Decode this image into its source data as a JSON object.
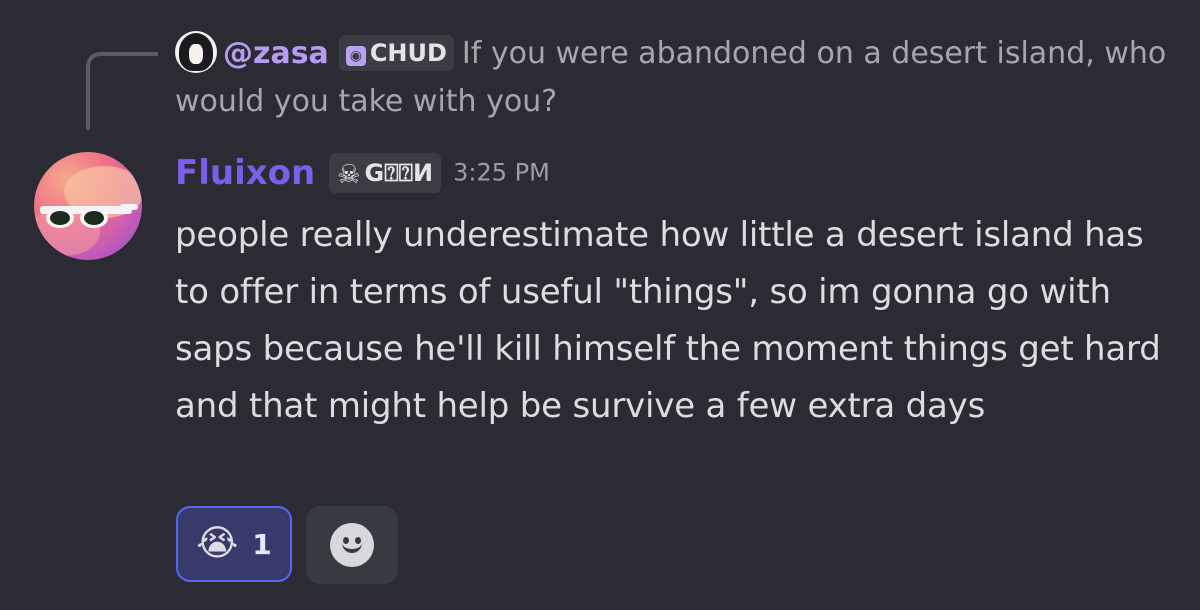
{
  "reply": {
    "username": "@zasa",
    "tag": "CHUD",
    "tag_icon": "shield-emblem-icon",
    "text": "If you were abandoned on a desert island, who would you take with you?"
  },
  "message": {
    "author": "Fluixon",
    "author_color": "#7c5ee8",
    "tag": "G⍰⍰И",
    "tag_icon": "skull-icon",
    "timestamp": "3:25 PM",
    "body": "people really underestimate how little a desert island has to offer in terms of useful \"things\", so im gonna go with saps because he'll kill himself the moment things get hard and that might help be survive a few extra days"
  },
  "reactions": [
    {
      "emoji": "😭",
      "emoji_name": "loudly-crying-face",
      "count": "1",
      "active": true
    }
  ],
  "add_reaction_icon": "smiley-icon",
  "colors": {
    "background": "#2b2c33",
    "reaction_active_bg": "#373a6a",
    "reaction_active_border": "#5865f2",
    "reply_username": "#b59cf0"
  }
}
